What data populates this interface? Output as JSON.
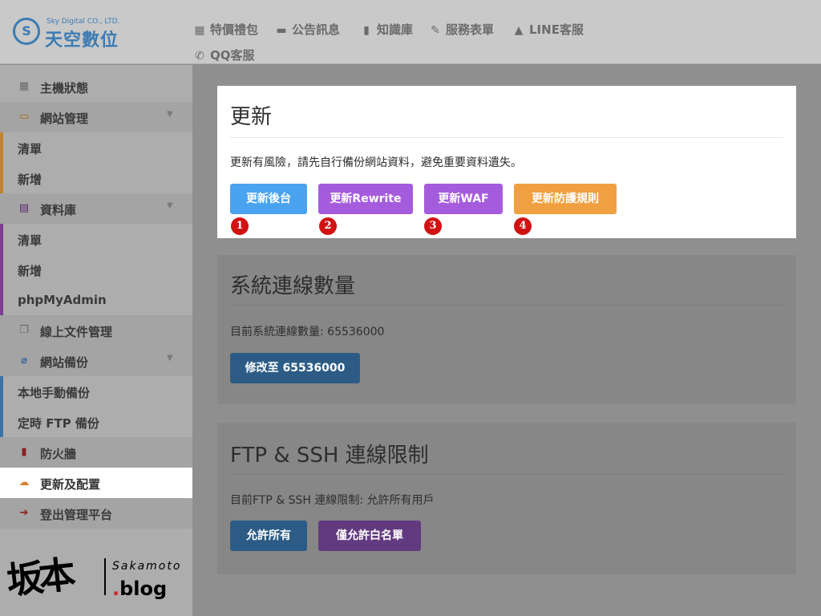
{
  "brand": {
    "name_en": "Sky Digital CO., LTD.",
    "name_zh": "天空數位",
    "mark": "S"
  },
  "topnav": {
    "items": [
      {
        "label": "特價禮包",
        "icon": "gift-icon"
      },
      {
        "label": "公告訊息",
        "icon": "comment-icon"
      },
      {
        "label": "知識庫",
        "icon": "book-icon"
      },
      {
        "label": "服務表單",
        "icon": "pencil-icon"
      },
      {
        "label": "LINE客服",
        "icon": "bell-icon"
      },
      {
        "label": "QQ客服",
        "icon": "phone-icon"
      }
    ]
  },
  "sidebar": {
    "items": [
      {
        "label": "主機狀態",
        "icon": "dashboard-icon"
      },
      {
        "label": "網站管理",
        "icon": "web-icon"
      },
      {
        "label": "清單"
      },
      {
        "label": "新增"
      },
      {
        "label": "資料庫",
        "icon": "database-icon"
      },
      {
        "label": "清單"
      },
      {
        "label": "新增"
      },
      {
        "label": "phpMyAdmin"
      },
      {
        "label": "線上文件管理",
        "icon": "files-icon"
      },
      {
        "label": "網站備份",
        "icon": "paperclip-icon"
      },
      {
        "label": "本地手動備份"
      },
      {
        "label": "定時 FTP 備份"
      },
      {
        "label": "防火牆",
        "icon": "clipboard-icon"
      },
      {
        "label": "更新及配置",
        "icon": "cloud-download-icon"
      },
      {
        "label": "登出管理平台",
        "icon": "sign-out-icon"
      }
    ]
  },
  "update_card": {
    "title": "更新",
    "notice": "更新有風險，請先自行備份網站資料，避免重要資料遺失。",
    "buttons": [
      {
        "label": "更新後台",
        "color": "#4aa3f0",
        "marker": "1"
      },
      {
        "label": "更新Rewrite",
        "color": "#a55cdc",
        "marker": "2"
      },
      {
        "label": "更新WAF",
        "color": "#a55cdc",
        "marker": "3"
      },
      {
        "label": "更新防護規則",
        "color": "#f0a040",
        "marker": "4"
      }
    ]
  },
  "connections_card": {
    "title": "系統連線數量",
    "current_text": "目前系統連線數量: 65536000",
    "button_label": "修改至 65536000"
  },
  "ftp_card": {
    "title": "FTP & SSH 連線限制",
    "current_text": "目前FTP & SSH 連線限制: 允許所有用戶",
    "allow_all_label": "允許所有",
    "whitelist_label": "僅允許白名單"
  },
  "watermark": {
    "zh": "坂本",
    "en": "Sakamoto",
    "blog_dot": ".",
    "blog": "blog"
  },
  "colors": {
    "accent_blue": "#4aa3f0",
    "accent_purple": "#a55cdc",
    "accent_orange": "#f0a040",
    "marker_red": "#d11212"
  }
}
